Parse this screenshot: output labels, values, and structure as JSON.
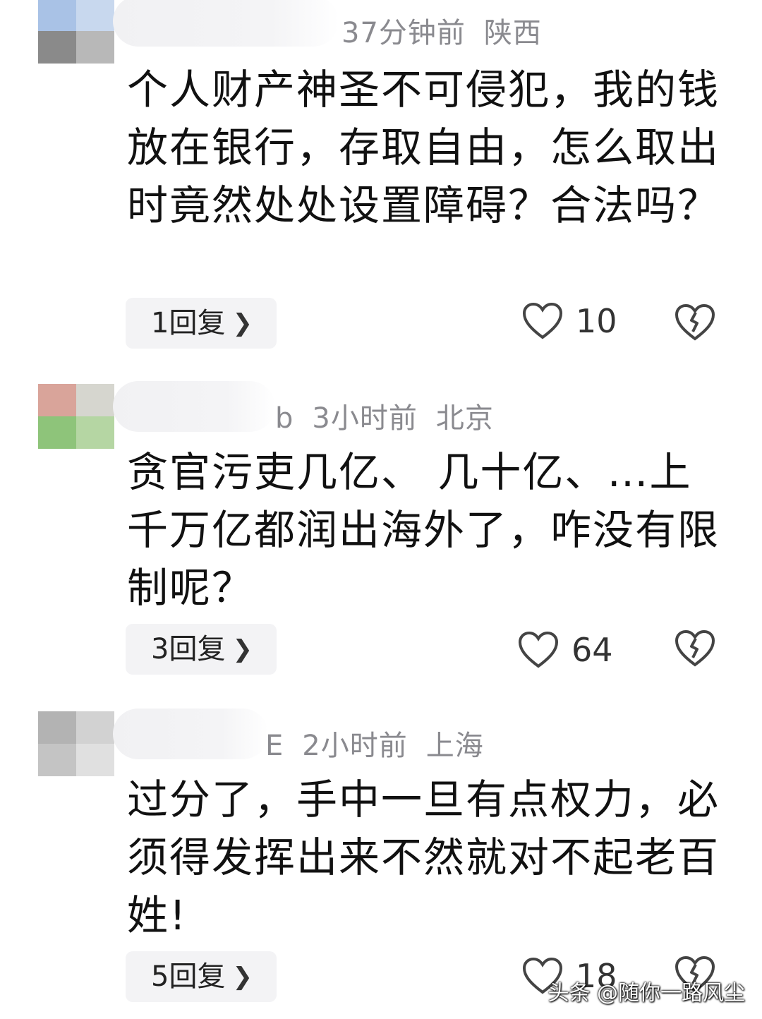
{
  "comments": [
    {
      "meta_time": "37分钟前",
      "meta_location": "陕西",
      "text": "个人财产神圣不可侵犯，我的钱放在银行，存取自由，怎么取出时竟然处处设置障碍？合法吗？",
      "reply_label": "1回复",
      "like_count": "10"
    },
    {
      "name_fragment": "b",
      "meta_time": "3小时前",
      "meta_location": "北京",
      "text": "贪官污吏几亿、 几十亿、…上千万亿都润出海外了，咋没有限制呢？",
      "reply_label": "3回复",
      "like_count": "64"
    },
    {
      "name_fragment": "E",
      "meta_time": "2小时前",
      "meta_location": "上海",
      "text": "过分了，手中一旦有点权力，必须得发挥出来不然就对不起老百姓!",
      "reply_label": "5回复",
      "like_count": "18"
    }
  ],
  "icons": {
    "like": "heart-outline-icon",
    "dislike": "broken-heart-icon",
    "reply_chevron": "chevron-right-icon"
  },
  "watermark": "头条 @随你一路风尘"
}
